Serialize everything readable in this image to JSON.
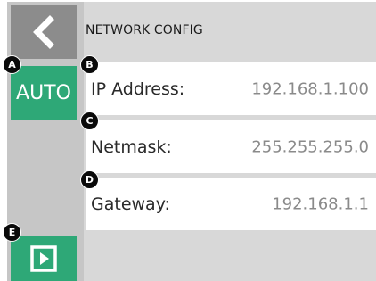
{
  "header": {
    "title": "NETWORK CONFIG"
  },
  "sidebar": {
    "back_icon": "chevron-left-icon",
    "auto_label": "AUTO",
    "play_icon": "play-icon"
  },
  "fields": [
    {
      "label": "IP Address:",
      "value": "192.168.1.100"
    },
    {
      "label": "Netmask:",
      "value": "255.255.255.0"
    },
    {
      "label": "Gateway:",
      "value": "192.168.1.1"
    }
  ],
  "markers": [
    "A",
    "B",
    "C",
    "D",
    "E"
  ],
  "colors": {
    "accent_green": "#2ea877",
    "back_button": "#8c8c8c",
    "sidebar": "#c6c6c6",
    "background": "#d8d8d8",
    "value_text": "#8a8a8a"
  }
}
